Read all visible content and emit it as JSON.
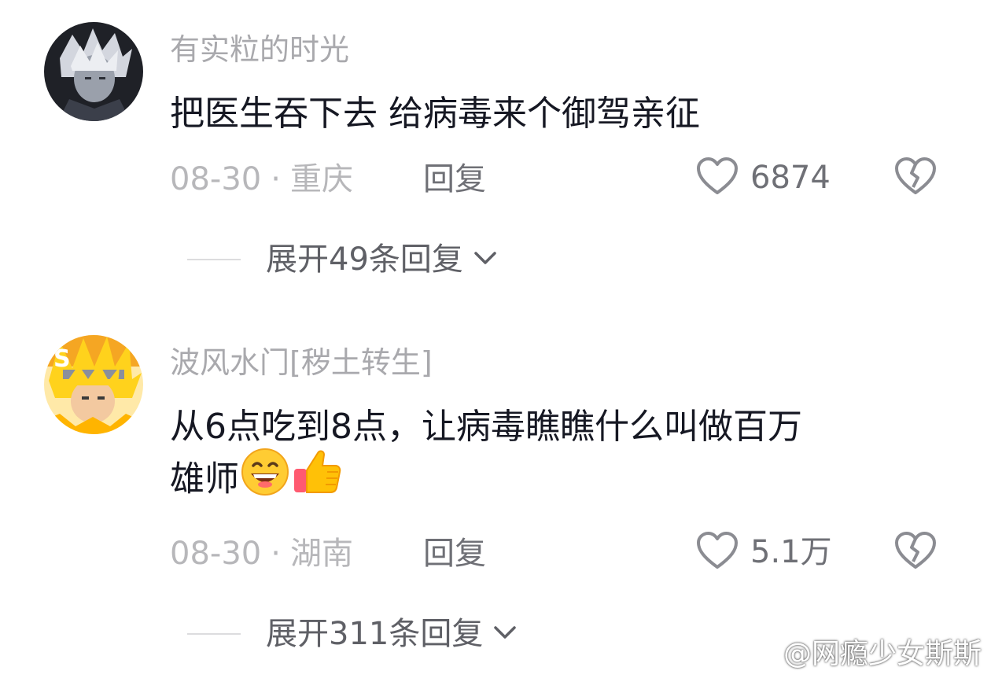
{
  "comments": [
    {
      "username": "有实粒的时光",
      "content_lines": [
        "把医生吞下去 给病毒来个御驾亲征"
      ],
      "date": "08-30",
      "separator": "·",
      "location": "重庆",
      "reply_label": "回复",
      "likes": "6874",
      "expand_label": "展开49条回复"
    },
    {
      "username": "波风水门[秽土转生]",
      "content_lines": [
        "从6点吃到8点，让病毒瞧瞧什么叫做百万",
        "雄师"
      ],
      "emojis": [
        "grinning-face-emoji",
        "thumbs-up-emoji"
      ],
      "date": "08-30",
      "separator": "·",
      "location": "湖南",
      "reply_label": "回复",
      "likes": "5.1万",
      "expand_label": "展开311条回复"
    }
  ],
  "watermark": {
    "text": "@网瘾少女斯斯",
    "icon": "weibo-logo"
  },
  "icons": {
    "like": "heart-outline-icon",
    "dislike": "broken-heart-icon",
    "expand": "chevron-down-icon"
  },
  "colors": {
    "username": "#a9a9ad",
    "content": "#161823",
    "meta": "#b7b7ba",
    "action": "#6f7076"
  }
}
